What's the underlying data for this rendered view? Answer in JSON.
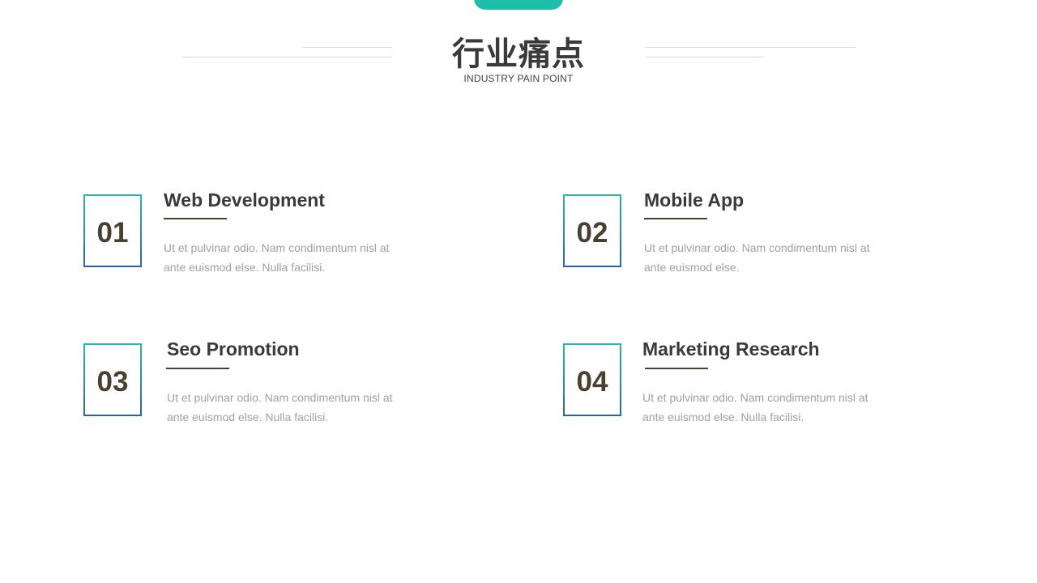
{
  "header": {
    "title": "行业痛点",
    "subtitle": "INDUSTRY PAIN POINT"
  },
  "items": [
    {
      "number": "01",
      "title": "Web Development",
      "description": "Ut et pulvinar odio. Nam condimentum nisl at ante euismod else. Nulla facilisi."
    },
    {
      "number": "02",
      "title": "Mobile App",
      "description": "Ut et pulvinar odio. Nam condimentum nisl at ante euismod else."
    },
    {
      "number": "03",
      "title": "Seo Promotion",
      "description": "Ut et pulvinar odio. Nam condimentum nisl at ante euismod else. Nulla facilisi."
    },
    {
      "number": "04",
      "title": "Marketing Research",
      "description": "Ut et pulvinar odio. Nam condimentum nisl at ante euismod else. Nulla facilisi."
    }
  ],
  "colors": {
    "accent": "#1dbfa8",
    "box_gradient_top": "#2db3ae",
    "box_gradient_bottom": "#2e62a8",
    "number_text": "#4a4030",
    "heading_text": "#3a3a3a",
    "body_text": "#a0a0a0"
  }
}
